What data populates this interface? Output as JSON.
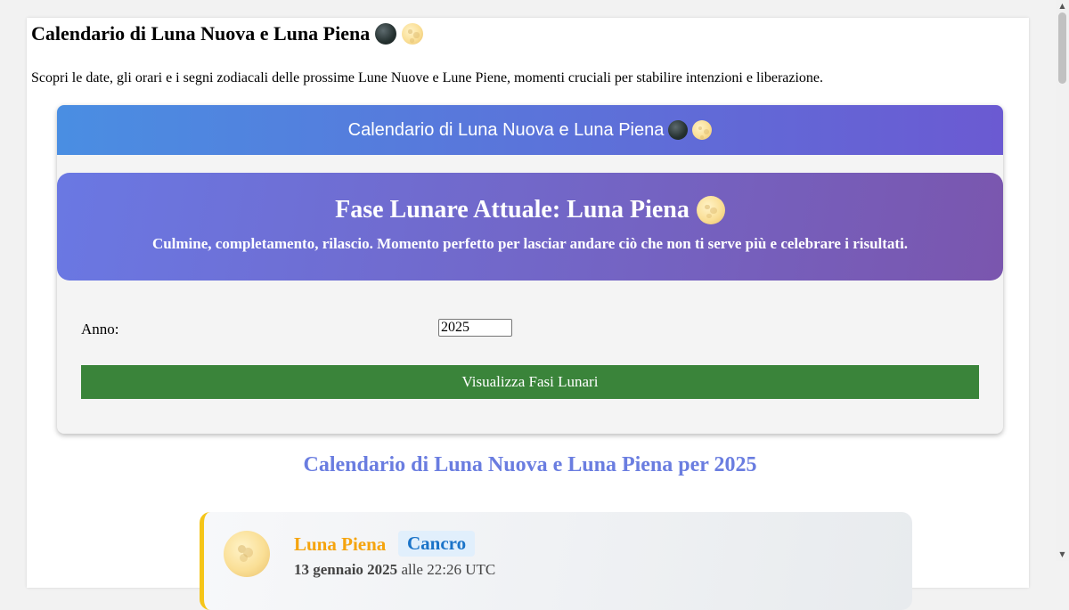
{
  "page": {
    "title": "Calendario di Luna Nuova e Luna Piena",
    "description": "Scopri le date, gli orari e i segni zodiacali delle prossime Lune Nuove e Lune Piene, momenti cruciali per stabilire intenzioni e liberazione."
  },
  "widget": {
    "header_title": "Calendario di Luna Nuova e Luna Piena",
    "current_phase": {
      "title": "Fase Lunare Attuale: Luna Piena",
      "description": "Culmine, completamento, rilascio. Momento perfetto per lasciar andare ciò che non ti serve più e celebrare i risultati.",
      "icon": "full-moon-icon"
    },
    "form": {
      "year_label": "Anno:",
      "year_value": "2025",
      "submit_label": "Visualizza Fasi Lunari"
    }
  },
  "calendar": {
    "section_title": "Calendario di Luna Nuova e Luna Piena per 2025",
    "events": [
      {
        "type": "Luna Piena",
        "sign": "Cancro",
        "date": "13 gennaio 2025",
        "time_text": "alle 22:26 UTC",
        "icon": "full-moon-icon"
      }
    ]
  },
  "colors": {
    "header_gradient": [
      "#4a8ee2",
      "#6b5ad2"
    ],
    "banner_gradient": [
      "#6a78e3",
      "#7a56ae"
    ],
    "button": "#3a843a",
    "section_title": "#6a7de0",
    "full_moon_label": "#f5a40e",
    "sign_label": "#1a73c8",
    "card_accent": "#f5c518"
  }
}
